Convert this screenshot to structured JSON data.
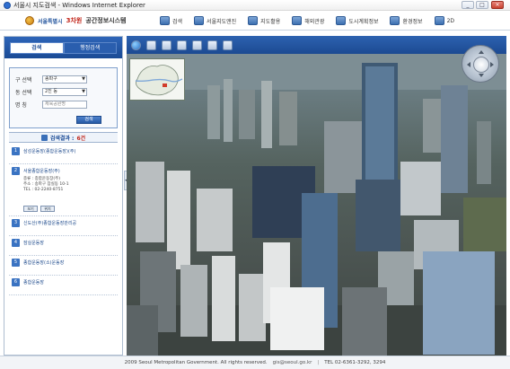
{
  "window": {
    "title": "서울시 지도검색 - Windows Internet Explorer",
    "minimize": "_",
    "maximize": "□",
    "close": "×"
  },
  "header": {
    "city": "서울특별시",
    "badge": "3차원",
    "system": "공간정보시스템",
    "nav": [
      {
        "label": "검색",
        "icon": "search-icon"
      },
      {
        "label": "서울지도앤진",
        "icon": "map-icon"
      },
      {
        "label": "지도활용",
        "icon": "tools-icon"
      },
      {
        "label": "해외관광",
        "icon": "globe-icon"
      },
      {
        "label": "도시계획정보",
        "icon": "building-icon"
      },
      {
        "label": "환경정보",
        "icon": "leaf-icon"
      },
      {
        "label": "2D",
        "icon": "2d-icon"
      }
    ]
  },
  "left": {
    "tabs": [
      "검색",
      "행정검색"
    ],
    "search": {
      "gu_label": "구  선택",
      "gu_value": "송파구",
      "dong_label": "동  선택",
      "dong_value": "2진 동",
      "name_label": "명  칭",
      "name_value": "체육공원명",
      "button": "검색"
    },
    "result_label": "검색결과 :",
    "result_count": "6건",
    "results": [
      {
        "num": "1",
        "name": "삼성운동장(종합운동장)(주)"
      },
      {
        "num": "2",
        "name": "서울종합운동장(주)",
        "detail1": "종류 : 종합운동장(주)",
        "detail2": "주소 : 송파구 잠실동 10-1",
        "detail3": "TEL : 02-2240-8751",
        "btn1": "보기",
        "btn2": "위치"
      },
      {
        "num": "3",
        "name": "신도산(주)종합운동장관리공"
      },
      {
        "num": "4",
        "name": "잠실운동장"
      },
      {
        "num": "5",
        "name": "종합운동장(소)운동장"
      },
      {
        "num": "6",
        "name": "종합운동장"
      }
    ]
  },
  "map_toolbar": [
    "globe-icon",
    "refresh-icon",
    "save-icon",
    "mail-icon",
    "print-icon",
    "measure-icon",
    "layer-icon"
  ],
  "footer": {
    "copyright": "2009 Seoul Metropolitan Government. All rights reserved.",
    "email": "gis@seoul.go.kr",
    "tel": "TEL 02-6361-3292, 3294"
  },
  "colors": {
    "panel_header": "#1a4a95",
    "result_count": "#c2261b"
  }
}
